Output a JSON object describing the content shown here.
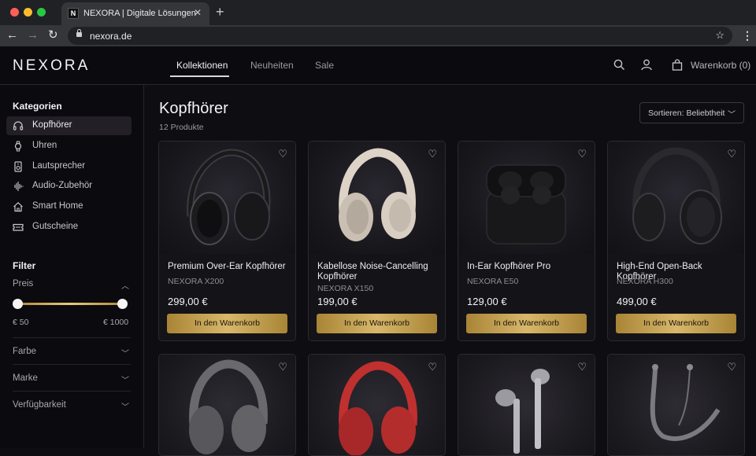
{
  "browser": {
    "tab_title": "NEXORA | Digitale Lösungen",
    "tab_favicon": "N",
    "url": "nexora.de",
    "traffic_colors": [
      "#ff5f57",
      "#febc2e",
      "#28c840"
    ]
  },
  "header": {
    "logo": "NEXORA",
    "nav": [
      {
        "label": "Kollektionen",
        "active": true
      },
      {
        "label": "Neuheiten",
        "active": false
      },
      {
        "label": "Sale",
        "active": false
      }
    ],
    "cart_label": "Warenkorb (0)",
    "icons": [
      "search-icon",
      "user-icon",
      "shopping-bag-icon"
    ]
  },
  "sidebar": {
    "categories_heading": "Kategorien",
    "categories": [
      {
        "label": "Kopfhörer",
        "icon": "headphones-icon",
        "active": true
      },
      {
        "label": "Uhren",
        "icon": "watch-icon",
        "active": false
      },
      {
        "label": "Lautsprecher",
        "icon": "speaker-icon",
        "active": false
      },
      {
        "label": "Audio-Zubehör",
        "icon": "waveform-icon",
        "active": false
      },
      {
        "label": "Smart Home",
        "icon": "home-icon",
        "active": false
      },
      {
        "label": "Gutscheine",
        "icon": "ticket-icon",
        "active": false
      }
    ],
    "filter_heading": "Filter",
    "price": {
      "label": "Preis",
      "min_label": "€ 50",
      "max_label": "€ 1000",
      "range_low": 0.0,
      "range_high": 1.0
    },
    "filters": [
      "Farbe",
      "Marke",
      "Verfügbarkeit"
    ]
  },
  "main": {
    "title": "Kopfhörer",
    "count": "12 Produkte",
    "sort_label": "Sortieren: Beliebtheit",
    "add_to_cart": "In den Warenkorb",
    "products": [
      {
        "name": "Premium Over-Ear Kopfhörer",
        "model": "NEXORA X200",
        "price": "299,00 €",
        "image": "black-headphones"
      },
      {
        "name": "Kabellose Noise-Cancelling Kopfhörer",
        "model": "NEXORA X150",
        "price": "199,00 €",
        "image": "beige-headphones"
      },
      {
        "name": "In-Ear Kopfhörer Pro",
        "model": "NEXORA E50",
        "price": "129,00 €",
        "image": "earbuds-case"
      },
      {
        "name": "High-End Open-Back Kopfhörer",
        "model": "NEXORA H300",
        "price": "499,00 €",
        "image": "open-back-headphones"
      }
    ],
    "products_row2": [
      {
        "image": "grey-headphones"
      },
      {
        "image": "red-headphones"
      },
      {
        "image": "silver-earphones"
      },
      {
        "image": "neckband-earphones"
      }
    ]
  },
  "colors": {
    "accent_gold": "#c9a65a",
    "background": "#0e0d12"
  }
}
